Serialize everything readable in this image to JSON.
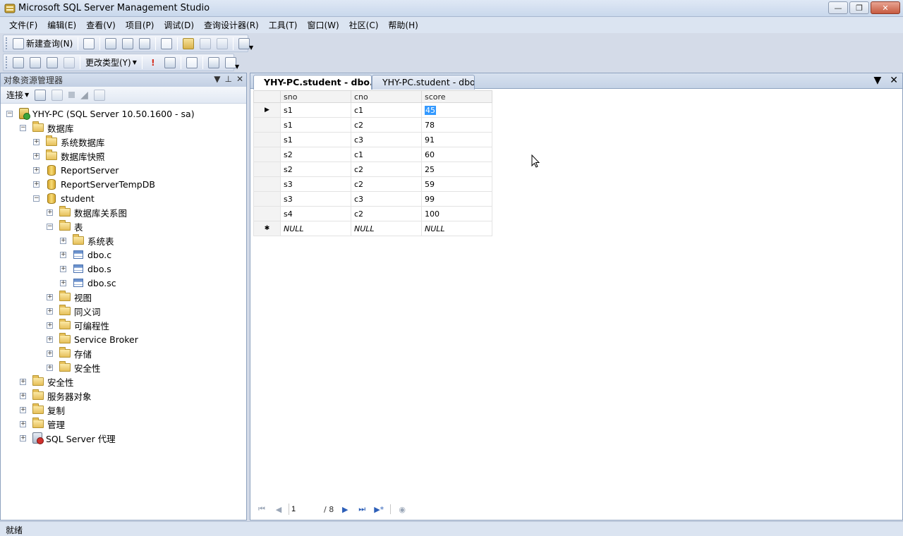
{
  "window": {
    "title": "Microsoft SQL Server Management Studio"
  },
  "menu": [
    "文件(F)",
    "编辑(E)",
    "查看(V)",
    "项目(P)",
    "调试(D)",
    "查询设计器(R)",
    "工具(T)",
    "窗口(W)",
    "社区(C)",
    "帮助(H)"
  ],
  "toolbar1": {
    "new_query_label": "新建查询(N)"
  },
  "toolbar2": {
    "change_type_label": "更改类型(Y)"
  },
  "object_explorer": {
    "title": "对象资源管理器",
    "connect_label": "连接",
    "tree": [
      {
        "label": "YHY-PC (SQL Server 10.50.1600 - sa)",
        "level": 0,
        "icon": "server-icon",
        "state": "expanded"
      },
      {
        "label": "数据库",
        "level": 1,
        "icon": "folder-icon",
        "state": "expanded"
      },
      {
        "label": "系统数据库",
        "level": 2,
        "icon": "folder-icon",
        "state": "collapsed"
      },
      {
        "label": "数据库快照",
        "level": 2,
        "icon": "folder-icon",
        "state": "collapsed"
      },
      {
        "label": "ReportServer",
        "level": 2,
        "icon": "database-icon",
        "state": "collapsed"
      },
      {
        "label": "ReportServerTempDB",
        "level": 2,
        "icon": "database-icon",
        "state": "collapsed"
      },
      {
        "label": "student",
        "level": 2,
        "icon": "database-icon",
        "state": "expanded"
      },
      {
        "label": "数据库关系图",
        "level": 3,
        "icon": "folder-icon",
        "state": "collapsed"
      },
      {
        "label": "表",
        "level": 3,
        "icon": "folder-icon",
        "state": "expanded"
      },
      {
        "label": "系统表",
        "level": 4,
        "icon": "folder-icon",
        "state": "collapsed"
      },
      {
        "label": "dbo.c",
        "level": 4,
        "icon": "table-icon",
        "state": "collapsed"
      },
      {
        "label": "dbo.s",
        "level": 4,
        "icon": "table-icon",
        "state": "collapsed"
      },
      {
        "label": "dbo.sc",
        "level": 4,
        "icon": "table-icon",
        "state": "collapsed"
      },
      {
        "label": "视图",
        "level": 3,
        "icon": "folder-icon",
        "state": "collapsed"
      },
      {
        "label": "同义词",
        "level": 3,
        "icon": "folder-icon",
        "state": "collapsed"
      },
      {
        "label": "可编程性",
        "level": 3,
        "icon": "folder-icon",
        "state": "collapsed"
      },
      {
        "label": "Service Broker",
        "level": 3,
        "icon": "folder-icon",
        "state": "collapsed"
      },
      {
        "label": "存储",
        "level": 3,
        "icon": "folder-icon",
        "state": "collapsed"
      },
      {
        "label": "安全性",
        "level": 3,
        "icon": "folder-icon",
        "state": "collapsed"
      },
      {
        "label": "安全性",
        "level": 1,
        "icon": "folder-icon",
        "state": "collapsed"
      },
      {
        "label": "服务器对象",
        "level": 1,
        "icon": "folder-icon",
        "state": "collapsed"
      },
      {
        "label": "复制",
        "level": 1,
        "icon": "folder-icon",
        "state": "collapsed"
      },
      {
        "label": "管理",
        "level": 1,
        "icon": "folder-icon",
        "state": "collapsed"
      },
      {
        "label": "SQL Server 代理",
        "level": 1,
        "icon": "agent-icon",
        "state": "collapsed"
      }
    ]
  },
  "tabs": [
    {
      "label": "YHY-PC.student - dbo.sc",
      "active": true
    },
    {
      "label": "YHY-PC.student - dbo.s",
      "active": false
    }
  ],
  "grid": {
    "columns": [
      "sno",
      "cno",
      "score"
    ],
    "rows": [
      [
        "s1",
        "c1",
        "45"
      ],
      [
        "s1",
        "c2",
        "78"
      ],
      [
        "s1",
        "c3",
        "91"
      ],
      [
        "s2",
        "c1",
        "60"
      ],
      [
        "s2",
        "c2",
        "25"
      ],
      [
        "s3",
        "c2",
        "59"
      ],
      [
        "s3",
        "c3",
        "99"
      ],
      [
        "s4",
        "c2",
        "100"
      ]
    ],
    "new_row": [
      "NULL",
      "NULL",
      "NULL"
    ]
  },
  "pager": {
    "current": "1",
    "total": "/ 8"
  },
  "status": {
    "text": "就绪"
  }
}
